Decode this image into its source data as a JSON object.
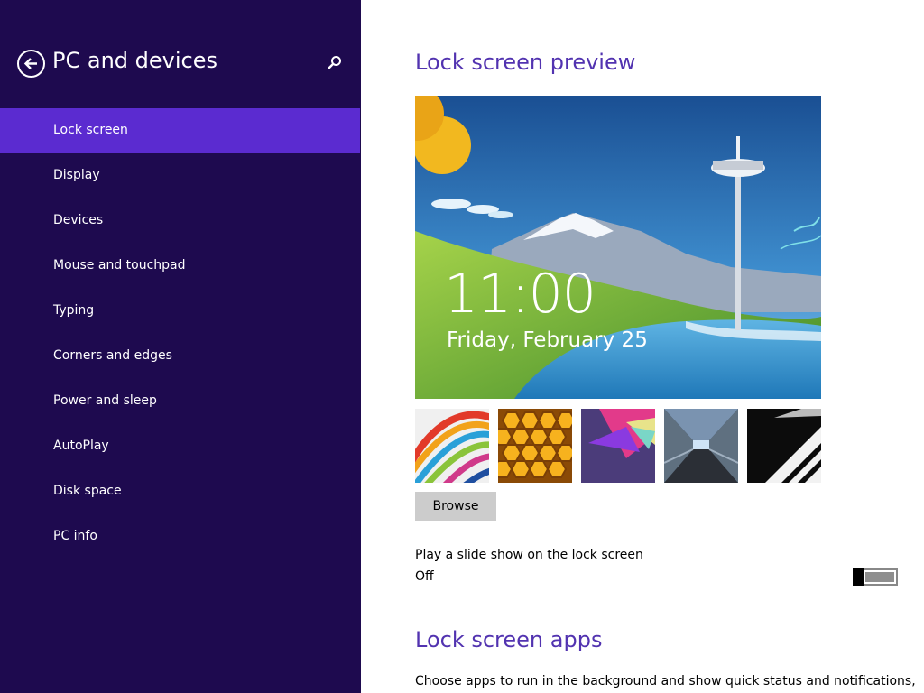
{
  "sidebar": {
    "title": "PC and devices",
    "items": [
      {
        "label": "Lock screen",
        "selected": true
      },
      {
        "label": "Display"
      },
      {
        "label": "Devices"
      },
      {
        "label": "Mouse and touchpad"
      },
      {
        "label": "Typing"
      },
      {
        "label": "Corners and edges"
      },
      {
        "label": "Power and sleep"
      },
      {
        "label": "AutoPlay"
      },
      {
        "label": "Disk space"
      },
      {
        "label": "PC info"
      }
    ]
  },
  "icons": {
    "back": "back-arrow-icon",
    "search": "search-icon"
  },
  "main": {
    "preview_title": "Lock screen preview",
    "preview": {
      "time": "11:00",
      "date": "Friday, February 25"
    },
    "thumbnails": [
      "colorful-streaks",
      "honeycomb",
      "geometric-shapes",
      "tunnel",
      "piano-keys"
    ],
    "browse_label": "Browse",
    "slideshow_label": "Play a slide show on the lock screen",
    "slideshow_state": "Off",
    "slideshow_on": false,
    "apps_title": "Lock screen apps",
    "apps_description": "Choose apps to run in the background and show quick status and notifications,"
  },
  "colors": {
    "sidebar_bg": "#1e0a4f",
    "selected_bg": "#5b2bd0",
    "heading": "#5233b0"
  }
}
